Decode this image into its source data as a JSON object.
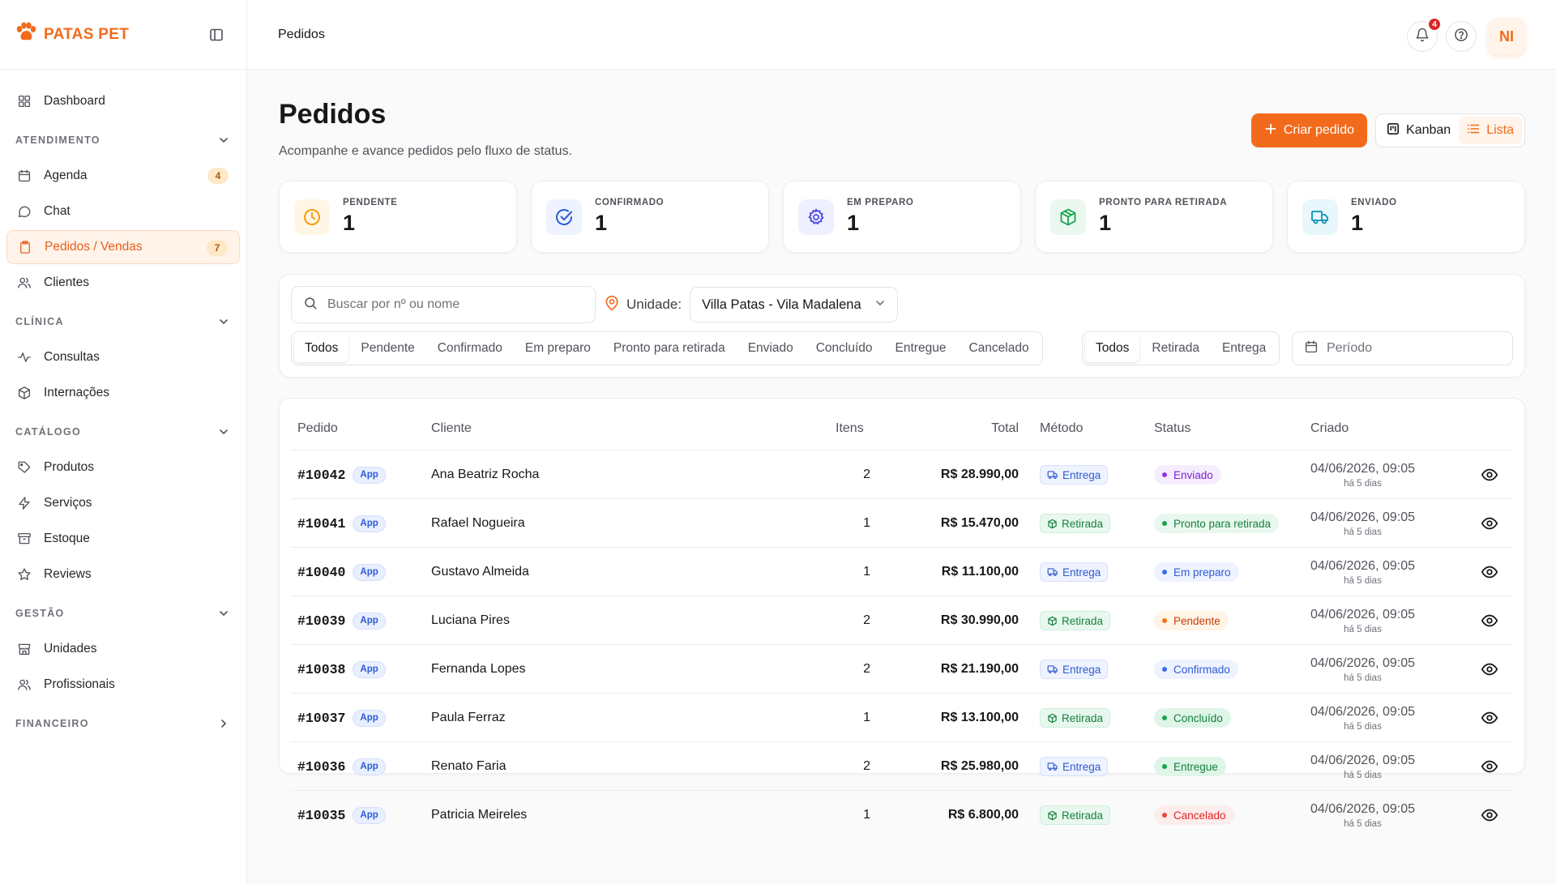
{
  "brand": {
    "name": "PATAS PET",
    "accent": "#f26a1b"
  },
  "header": {
    "breadcrumb": "Pedidos",
    "notifications_count": "4",
    "avatar_initials": "NI"
  },
  "sidebar": {
    "items": [
      {
        "key": "dashboard",
        "label": "Dashboard",
        "icon": "grid-icon"
      }
    ],
    "sections": [
      {
        "title": "ATENDIMENTO",
        "expanded": true,
        "items": [
          {
            "key": "agenda",
            "label": "Agenda",
            "badge": "4",
            "icon": "calendar-icon"
          },
          {
            "key": "chat",
            "label": "Chat",
            "icon": "chat-icon"
          },
          {
            "key": "pedidos",
            "label": "Pedidos / Vendas",
            "badge": "7",
            "active": true,
            "icon": "clipboard-icon"
          },
          {
            "key": "clientes",
            "label": "Clientes",
            "icon": "users-icon"
          }
        ]
      },
      {
        "title": "CLÍNICA",
        "expanded": true,
        "items": [
          {
            "key": "consultas",
            "label": "Consultas",
            "icon": "activity-icon"
          },
          {
            "key": "internacoes",
            "label": "Internações",
            "icon": "box-icon"
          }
        ]
      },
      {
        "title": "CATÁLOGO",
        "expanded": true,
        "items": [
          {
            "key": "produtos",
            "label": "Produtos",
            "icon": "tag-icon"
          },
          {
            "key": "servicos",
            "label": "Serviços",
            "icon": "bolt-icon"
          },
          {
            "key": "estoque",
            "label": "Estoque",
            "icon": "archive-icon"
          },
          {
            "key": "reviews",
            "label": "Reviews",
            "icon": "star-icon"
          }
        ]
      },
      {
        "title": "GESTÃO",
        "expanded": true,
        "items": [
          {
            "key": "unidades",
            "label": "Unidades",
            "icon": "store-icon"
          },
          {
            "key": "profissionais",
            "label": "Profissionais",
            "icon": "users-icon"
          }
        ]
      },
      {
        "title": "FINANCEIRO",
        "expanded": false,
        "items": []
      }
    ]
  },
  "page": {
    "title": "Pedidos",
    "subtitle": "Acompanhe e avance pedidos pelo fluxo de status.",
    "create_button": "Criar pedido",
    "view_kanban": "Kanban",
    "view_list": "Lista"
  },
  "stats": [
    {
      "label": "PENDENTE",
      "value": "1",
      "color": "#f59e0b",
      "bg": "#fff6e6",
      "icon": "clock-icon"
    },
    {
      "label": "CONFIRMADO",
      "value": "1",
      "color": "#2f5bd3",
      "bg": "#eef3ff",
      "icon": "check-circle-icon"
    },
    {
      "label": "EM PREPARO",
      "value": "1",
      "color": "#4f46e5",
      "bg": "#eff0ff",
      "icon": "gear-icon"
    },
    {
      "label": "PRONTO PARA RETIRADA",
      "value": "1",
      "color": "#16a34a",
      "bg": "#eaf8ef",
      "icon": "package-icon"
    },
    {
      "label": "ENVIADO",
      "value": "1",
      "color": "#0891b2",
      "bg": "#e8f7fb",
      "icon": "truck-icon"
    }
  ],
  "filters": {
    "search_placeholder": "Buscar por nº ou nome",
    "unit_label": "Unidade:",
    "unit_value": "Villa Patas - Vila Madalena",
    "status_tabs": [
      "Todos",
      "Pendente",
      "Confirmado",
      "Em preparo",
      "Pronto para retirada",
      "Enviado",
      "Concluído",
      "Entregue",
      "Cancelado"
    ],
    "status_active": 0,
    "method_tabs": [
      "Todos",
      "Retirada",
      "Entrega"
    ],
    "method_active": 0,
    "period_placeholder": "Período"
  },
  "table": {
    "columns": {
      "pedido": "Pedido",
      "cliente": "Cliente",
      "itens": "Itens",
      "total": "Total",
      "metodo": "Método",
      "status": "Status",
      "criado": "Criado"
    },
    "rows": [
      {
        "id": "#10042",
        "channel": "App",
        "client": "Ana Beatriz Rocha",
        "items": "2",
        "total": "R$ 28.990,00",
        "method": "Entrega",
        "status": "Enviado",
        "created": "04/06/2026, 09:05",
        "ago": "há 5 dias"
      },
      {
        "id": "#10041",
        "channel": "App",
        "client": "Rafael Nogueira",
        "items": "1",
        "total": "R$ 15.470,00",
        "method": "Retirada",
        "status": "Pronto para retirada",
        "created": "04/06/2026, 09:05",
        "ago": "há 5 dias"
      },
      {
        "id": "#10040",
        "channel": "App",
        "client": "Gustavo Almeida",
        "items": "1",
        "total": "R$ 11.100,00",
        "method": "Entrega",
        "status": "Em preparo",
        "created": "04/06/2026, 09:05",
        "ago": "há 5 dias"
      },
      {
        "id": "#10039",
        "channel": "App",
        "client": "Luciana Pires",
        "items": "2",
        "total": "R$ 30.990,00",
        "method": "Retirada",
        "status": "Pendente",
        "created": "04/06/2026, 09:05",
        "ago": "há 5 dias"
      },
      {
        "id": "#10038",
        "channel": "App",
        "client": "Fernanda Lopes",
        "items": "2",
        "total": "R$ 21.190,00",
        "method": "Entrega",
        "status": "Confirmado",
        "created": "04/06/2026, 09:05",
        "ago": "há 5 dias"
      },
      {
        "id": "#10037",
        "channel": "App",
        "client": "Paula Ferraz",
        "items": "1",
        "total": "R$ 13.100,00",
        "method": "Retirada",
        "status": "Concluído",
        "created": "04/06/2026, 09:05",
        "ago": "há 5 dias"
      },
      {
        "id": "#10036",
        "channel": "App",
        "client": "Renato Faria",
        "items": "2",
        "total": "R$ 25.980,00",
        "method": "Entrega",
        "status": "Entregue",
        "created": "04/06/2026, 09:05",
        "ago": "há 5 dias"
      },
      {
        "id": "#10035",
        "channel": "App",
        "client": "Patricia Meireles",
        "items": "1",
        "total": "R$ 6.800,00",
        "method": "Retirada",
        "status": "Cancelado",
        "created": "04/06/2026, 09:05",
        "ago": "há 5 dias"
      }
    ]
  },
  "status_colors": {
    "Enviado": {
      "bg": "#f5edff",
      "fg": "#7e22ce",
      "dot": "#9333ea"
    },
    "Pronto para retirada": {
      "bg": "#e9f8ef",
      "fg": "#15803d",
      "dot": "#16a34a"
    },
    "Em preparo": {
      "bg": "#eef3ff",
      "fg": "#2f5bd3",
      "dot": "#3b6cf0"
    },
    "Pendente": {
      "bg": "#fff4e5",
      "fg": "#c2410c",
      "dot": "#f97316"
    },
    "Confirmado": {
      "bg": "#eef3ff",
      "fg": "#2f5bd3",
      "dot": "#3b6cf0"
    },
    "Concluído": {
      "bg": "#dff5e8",
      "fg": "#15803d",
      "dot": "#16a34a"
    },
    "Entregue": {
      "bg": "#dff5e8",
      "fg": "#15803d",
      "dot": "#16a34a"
    },
    "Cancelado": {
      "bg": "#fdecec",
      "fg": "#dc2626",
      "dot": "#ef4444"
    }
  }
}
